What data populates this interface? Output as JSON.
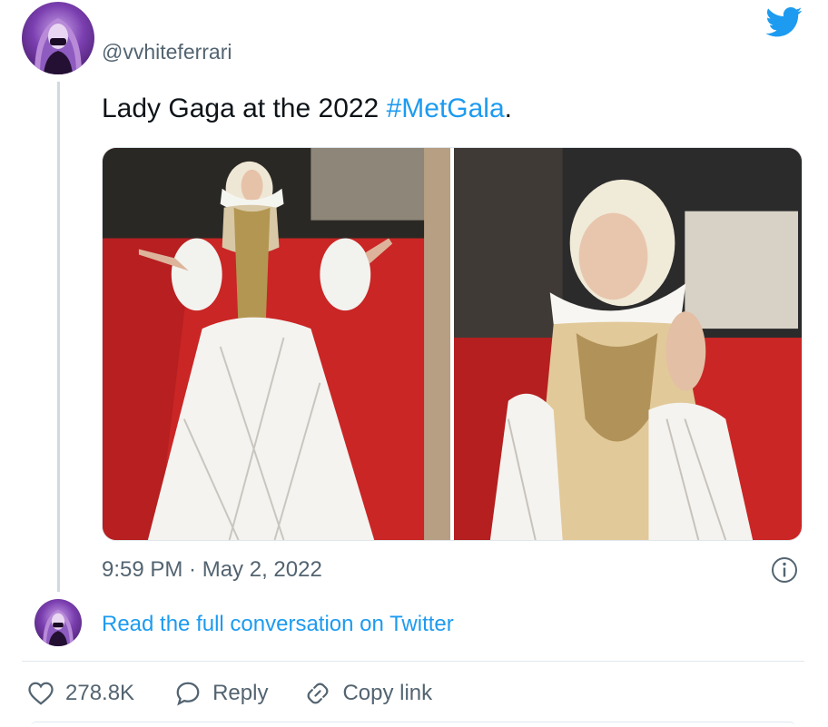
{
  "tweet": {
    "username": "@vvhiteferrari",
    "text_prefix": "Lady Gaga at the 2022 ",
    "hashtag": "#MetGala",
    "text_suffix": ".",
    "timestamp": "9:59 PM · May 2, 2022",
    "read_full_link": "Read the full conversation on Twitter",
    "likes": "278.8K",
    "reply_label": "Reply",
    "copy_link_label": "Copy link",
    "media": [
      {
        "icon": "photo-full-length-red-carpet"
      },
      {
        "icon": "photo-close-up-red-carpet"
      }
    ]
  },
  "icons": {
    "brand": "twitter-bird-icon",
    "info": "info-icon",
    "like": "heart-icon",
    "reply": "speech-bubble-icon",
    "copy": "link-icon"
  },
  "colors": {
    "accent": "#1d9bf0",
    "muted_text": "#536471",
    "primary_text": "#0f1419",
    "divider": "#e1e8ed"
  }
}
